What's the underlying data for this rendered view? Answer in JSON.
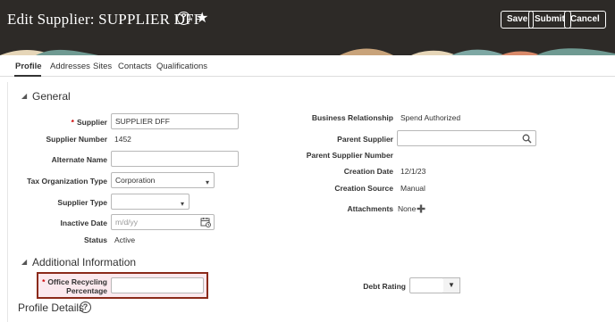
{
  "header": {
    "title": "Edit Supplier: SUPPLIER DFF",
    "help_glyph": "?",
    "star_glyph": "★",
    "buttons": {
      "save": "Save",
      "submit": "Submit",
      "cancel": "Cancel"
    }
  },
  "tabs": [
    "Profile",
    "Addresses",
    "Sites",
    "Contacts",
    "Qualifications"
  ],
  "general": {
    "title": "General",
    "supplier": {
      "label": "Supplier",
      "value": "SUPPLIER DFF"
    },
    "supplier_number": {
      "label": "Supplier Number",
      "value": "1452"
    },
    "alternate_name": {
      "label": "Alternate Name",
      "value": ""
    },
    "tax_org_type": {
      "label": "Tax Organization Type",
      "value": "Corporation"
    },
    "supplier_type": {
      "label": "Supplier Type",
      "value": ""
    },
    "inactive_date": {
      "label": "Inactive Date",
      "placeholder": "m/d/yy"
    },
    "status": {
      "label": "Status",
      "value": "Active"
    },
    "business_relationship": {
      "label": "Business Relationship",
      "value": "Spend Authorized"
    },
    "parent_supplier": {
      "label": "Parent Supplier",
      "value": ""
    },
    "parent_supplier_number": {
      "label": "Parent Supplier Number",
      "value": ""
    },
    "creation_date": {
      "label": "Creation Date",
      "value": "12/1/23"
    },
    "creation_source": {
      "label": "Creation Source",
      "value": "Manual"
    },
    "attachments": {
      "label": "Attachments",
      "value": "None"
    }
  },
  "additional": {
    "title": "Additional Information",
    "office_recycling": {
      "label_line1": "Office Recycling",
      "label_line2": "Percentage",
      "value": ""
    },
    "debt_rating": {
      "label": "Debt Rating",
      "value": ""
    }
  },
  "profile_details": {
    "title": "Profile Details"
  },
  "icons": {
    "required": "*",
    "search": "search-icon",
    "calendar": "calendar-icon",
    "add": "plus-icon",
    "chevron": "chevron-down-icon"
  }
}
